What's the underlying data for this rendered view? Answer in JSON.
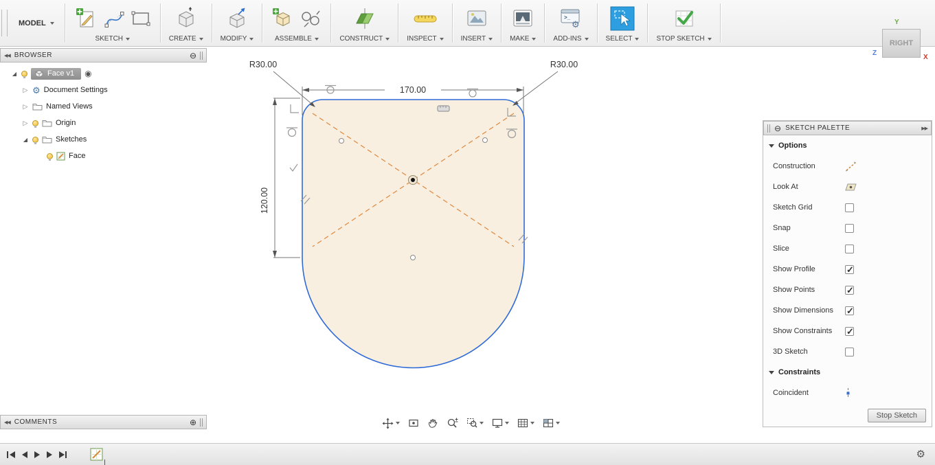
{
  "glyphs": {
    "collapse_left": "◀◀",
    "panel_minus": "⊖",
    "panel_plus": "⊕",
    "pin_right": "▶▶",
    "gear": "⚙",
    "tree_expanded": "◢",
    "tree_collapsed": "▷",
    "target": "◉",
    "terminal_prompt": ">_"
  },
  "toolbar": {
    "workspace_label": "MODEL",
    "groups": [
      {
        "label": "SKETCH"
      },
      {
        "label": "CREATE"
      },
      {
        "label": "MODIFY"
      },
      {
        "label": "ASSEMBLE"
      },
      {
        "label": "CONSTRUCT"
      },
      {
        "label": "INSPECT"
      },
      {
        "label": "INSERT"
      },
      {
        "label": "MAKE"
      },
      {
        "label": "ADD-INS"
      },
      {
        "label": "SELECT"
      },
      {
        "label": "STOP SKETCH"
      }
    ]
  },
  "browser": {
    "title": "BROWSER",
    "root_label": "Face v1",
    "items": [
      {
        "label": "Document Settings"
      },
      {
        "label": "Named Views"
      },
      {
        "label": "Origin"
      },
      {
        "label": "Sketches"
      },
      {
        "label": "Face"
      }
    ]
  },
  "viewcube": {
    "face_label": "RIGHT",
    "axis_y": "Y",
    "axis_z": "Z",
    "axis_x": "X"
  },
  "canvas": {
    "dimensions": {
      "width": "170.00",
      "height": "120.00",
      "radius_left": "R30.00",
      "radius_right": "R30.00"
    }
  },
  "palette": {
    "title": "SKETCH PALETTE",
    "options_header": "Options",
    "constraints_header": "Constraints",
    "options": [
      {
        "label": "Construction"
      },
      {
        "label": "Look At"
      },
      {
        "label": "Sketch Grid",
        "checked": false
      },
      {
        "label": "Snap",
        "checked": false
      },
      {
        "label": "Slice",
        "checked": false
      },
      {
        "label": "Show Profile",
        "checked": true
      },
      {
        "label": "Show Points",
        "checked": true
      },
      {
        "label": "Show Dimensions",
        "checked": true
      },
      {
        "label": "Show Constraints",
        "checked": true
      },
      {
        "label": "3D Sketch",
        "checked": false
      }
    ],
    "constraints": [
      {
        "label": "Coincident"
      }
    ],
    "stop_sketch_label": "Stop Sketch"
  },
  "comments": {
    "title": "COMMENTS"
  }
}
